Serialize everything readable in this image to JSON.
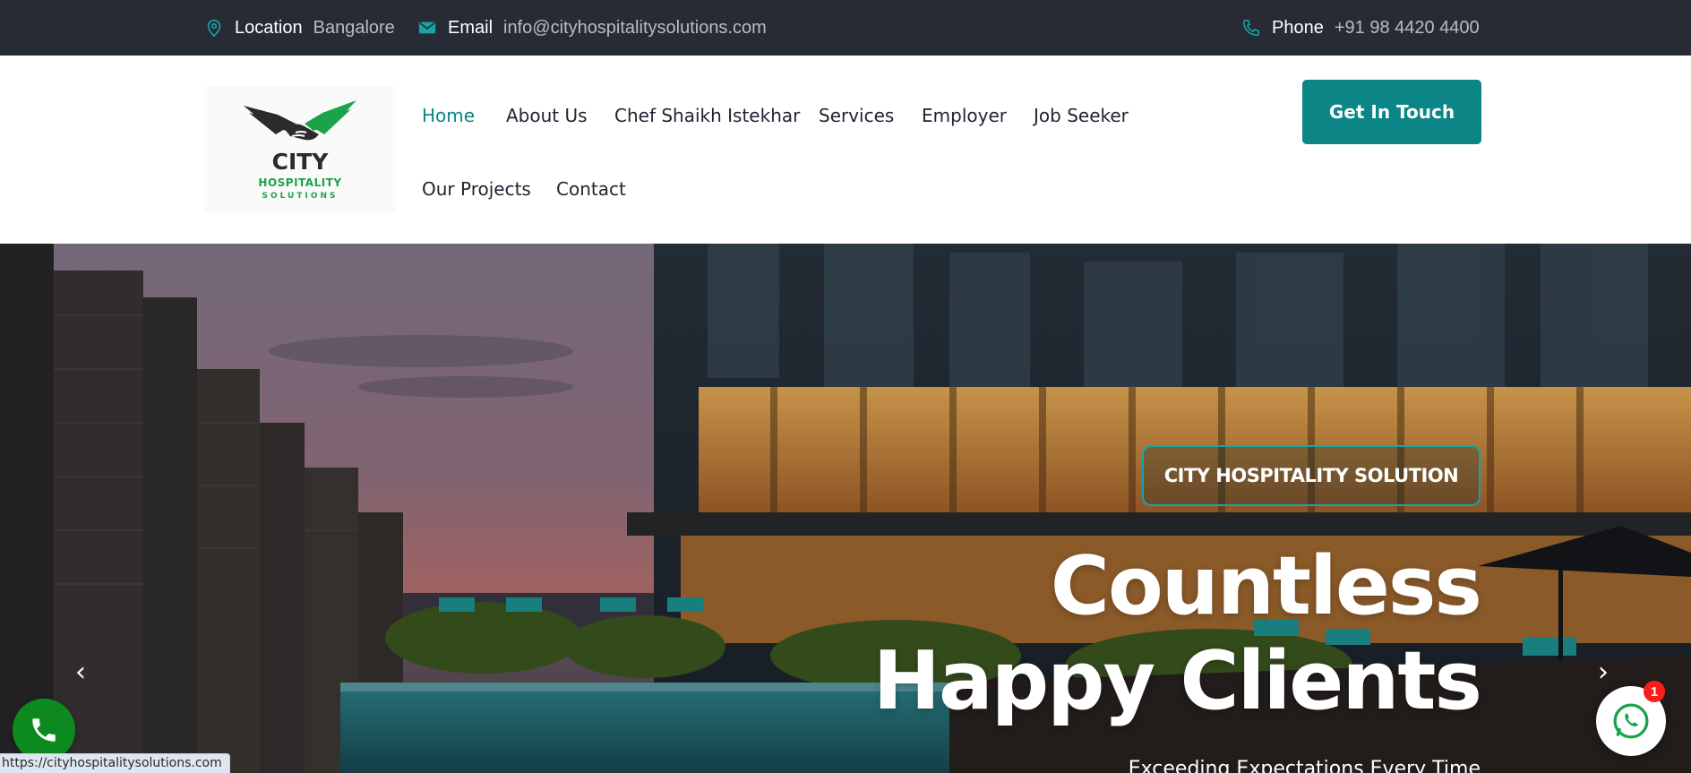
{
  "topbar": {
    "location_label": "Location",
    "location_value": "Bangalore",
    "email_label": "Email",
    "email_value": "info@cityhospitalitysolutions.com",
    "phone_label": "Phone",
    "phone_value": "+91 98 4420 4400",
    "icons": [
      "location-pin-icon",
      "envelope-icon",
      "phone-icon"
    ]
  },
  "logo": {
    "line1": "CITY",
    "line2": "HOSPITALITY",
    "line3": "SOLUTIONS"
  },
  "nav": {
    "items": [
      {
        "label": "Home",
        "active": true
      },
      {
        "label": "About Us"
      },
      {
        "label": "Chef Shaikh Istekhar"
      },
      {
        "label": "Services"
      },
      {
        "label": "Employer"
      },
      {
        "label": "Job Seeker"
      },
      {
        "label": "Our Projects"
      },
      {
        "label": "Contact"
      }
    ],
    "cta_label": "Get In Touch"
  },
  "hero": {
    "badge": "CITY HOSPITALITY SOLUTION",
    "title_line1": "Countless",
    "title_line2": "Happy Clients",
    "subtitle": "Exceeding Expectations Every Time",
    "prev_arrow": "‹",
    "next_arrow": "›"
  },
  "widgets": {
    "whatsapp_count": "1",
    "status_url": "https://cityhospitalitysolutions.com"
  },
  "colors": {
    "topbar_bg": "#262b36",
    "accent_teal": "#0b8585",
    "logo_green": "#1aa34a",
    "call_green": "#0d8a1f",
    "badge_red": "#ff1b1b"
  }
}
